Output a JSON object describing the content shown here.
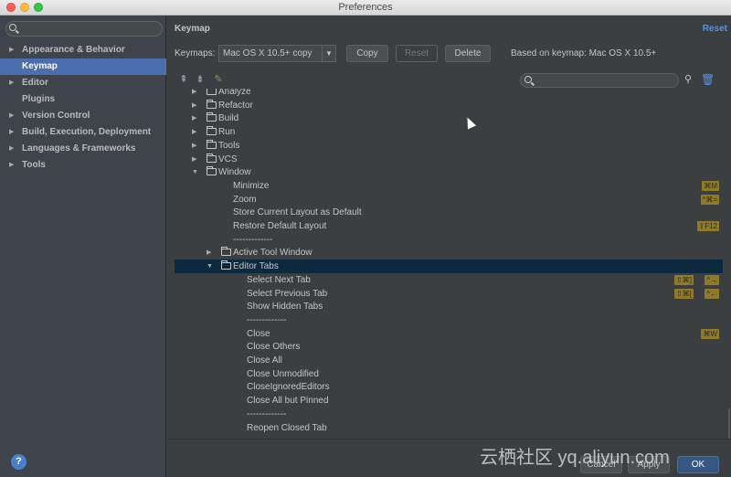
{
  "window": {
    "title": "Preferences"
  },
  "sidebar": {
    "search_placeholder": "",
    "items": [
      {
        "label": "Appearance & Behavior",
        "arrow": "▶",
        "selected": false
      },
      {
        "label": "Keymap",
        "arrow": "",
        "selected": true
      },
      {
        "label": "Editor",
        "arrow": "▶",
        "selected": false
      },
      {
        "label": "Plugins",
        "arrow": "",
        "selected": false
      },
      {
        "label": "Version Control",
        "arrow": "▶",
        "selected": false
      },
      {
        "label": "Build, Execution, Deployment",
        "arrow": "▶",
        "selected": false
      },
      {
        "label": "Languages & Frameworks",
        "arrow": "▶",
        "selected": false
      },
      {
        "label": "Tools",
        "arrow": "▶",
        "selected": false
      }
    ],
    "help": "?"
  },
  "main": {
    "title": "Keymap",
    "reset_link": "Reset",
    "keymaps_label": "Keymaps:",
    "keymap_value": "Mac OS X 10.5+ copy",
    "copy_button": "Copy",
    "reset_button": "Reset",
    "delete_button": "Delete",
    "based_on": "Based on keymap: Mac OS X 10.5+",
    "filter_placeholder": ""
  },
  "tree": {
    "rows": [
      {
        "label": "Analyze",
        "type": "folder",
        "level": 1,
        "expanded": false,
        "shortcuts": []
      },
      {
        "label": "Refactor",
        "type": "folder",
        "level": 1,
        "expanded": false,
        "shortcuts": []
      },
      {
        "label": "Build",
        "type": "folder",
        "level": 1,
        "expanded": false,
        "shortcuts": []
      },
      {
        "label": "Run",
        "type": "folder",
        "level": 1,
        "expanded": false,
        "shortcuts": []
      },
      {
        "label": "Tools",
        "type": "folder",
        "level": 1,
        "expanded": false,
        "shortcuts": []
      },
      {
        "label": "VCS",
        "type": "folder",
        "level": 1,
        "expanded": false,
        "shortcuts": []
      },
      {
        "label": "Window",
        "type": "folder",
        "level": 1,
        "expanded": true,
        "shortcuts": []
      },
      {
        "label": "Minimize",
        "type": "action",
        "level": 2,
        "shortcuts": [
          "⌘M"
        ]
      },
      {
        "label": "Zoom",
        "type": "action",
        "level": 2,
        "shortcuts": [
          "^⌘="
        ]
      },
      {
        "label": "Store Current Layout as Default",
        "type": "action",
        "level": 2,
        "shortcuts": []
      },
      {
        "label": "Restore Default Layout",
        "type": "action",
        "level": 2,
        "shortcuts": [
          "⇧F12"
        ]
      },
      {
        "label": "-------------",
        "type": "separator",
        "level": 2,
        "shortcuts": []
      },
      {
        "label": "Active Tool Window",
        "type": "folder",
        "level": 2,
        "expanded": false,
        "shortcuts": []
      },
      {
        "label": "Editor Tabs",
        "type": "folder",
        "level": 2,
        "expanded": true,
        "selected": true,
        "shortcuts": []
      },
      {
        "label": "Select Next Tab",
        "type": "action",
        "level": 3,
        "shortcuts": [
          "⇧⌘]",
          "^→"
        ]
      },
      {
        "label": "Select Previous Tab",
        "type": "action",
        "level": 3,
        "shortcuts": [
          "⇧⌘[",
          "^←"
        ]
      },
      {
        "label": "Show Hidden Tabs",
        "type": "action",
        "level": 3,
        "shortcuts": []
      },
      {
        "label": "-------------",
        "type": "separator",
        "level": 3,
        "shortcuts": []
      },
      {
        "label": "Close",
        "type": "action",
        "level": 3,
        "shortcuts": [
          "⌘W"
        ]
      },
      {
        "label": "Close Others",
        "type": "action",
        "level": 3,
        "shortcuts": []
      },
      {
        "label": "Close All",
        "type": "action",
        "level": 3,
        "shortcuts": []
      },
      {
        "label": "Close Unmodified",
        "type": "action",
        "level": 3,
        "shortcuts": []
      },
      {
        "label": "CloseIgnoredEditors",
        "type": "action",
        "level": 3,
        "shortcuts": []
      },
      {
        "label": "Close All but Pinned",
        "type": "action",
        "level": 3,
        "shortcuts": []
      },
      {
        "label": "-------------",
        "type": "separator",
        "level": 3,
        "shortcuts": []
      },
      {
        "label": "Reopen Closed Tab",
        "type": "action",
        "level": 3,
        "shortcuts": []
      }
    ]
  },
  "footer": {
    "cancel": "Cancel",
    "apply": "Apply",
    "ok": "OK"
  },
  "watermark": "云栖社区 yq.aliyun.com",
  "colors": {
    "selection": "#4b6eaf",
    "tree_selection": "#0d293e",
    "accent_link": "#5394ec",
    "shortcut_badge": "#8d7a2a"
  }
}
